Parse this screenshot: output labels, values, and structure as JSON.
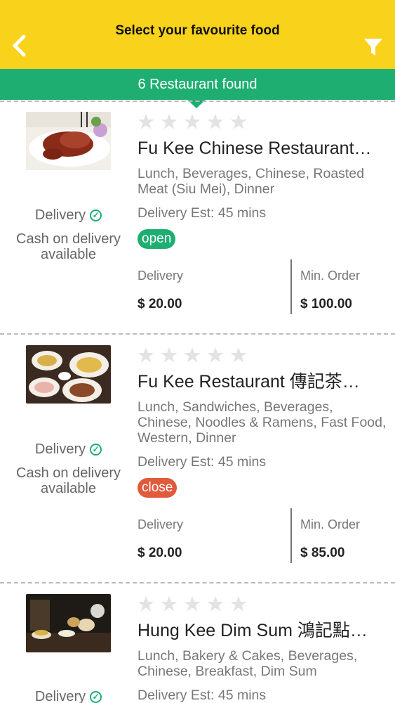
{
  "header": {
    "title": "Select your favourite food",
    "banner": "6 Restaurant found"
  },
  "colors": {
    "header_bg": "#f9d21b",
    "banner_bg": "#1fae72",
    "open_badge": "#1fae72",
    "close_badge": "#e05a3c"
  },
  "icons": [
    "back-arrow-icon",
    "filter-icon",
    "star-icon",
    "check-circle-icon"
  ],
  "restaurants": [
    {
      "name": "Fu Kee Chinese Restaurant…",
      "cuisines": "Lunch, Beverages, Chinese, Roasted Meat (Siu Mei), Dinner",
      "eta": "Delivery Est: 45 mins",
      "status": "open",
      "rating": 0,
      "delivery_label": "Delivery",
      "cash_label": "Cash on delivery available",
      "fee_label": "Delivery",
      "fee_value": "$ 20.00",
      "min_label": "Min. Order",
      "min_value": "$ 100.00"
    },
    {
      "name": "Fu Kee Restaurant 傳記茶…",
      "cuisines": "Lunch, Sandwiches, Beverages, Chinese, Noodles & Ramens, Fast Food, Western, Dinner",
      "eta": "Delivery Est: 45 mins",
      "status": "close",
      "rating": 0,
      "delivery_label": "Delivery",
      "cash_label": "Cash on delivery available",
      "fee_label": "Delivery",
      "fee_value": "$ 20.00",
      "min_label": "Min. Order",
      "min_value": "$ 85.00"
    },
    {
      "name": "Hung Kee Dim Sum 鴻記點…",
      "cuisines": "Lunch, Bakery & Cakes, Beverages, Chinese, Breakfast, Dim Sum",
      "eta": "Delivery Est: 45 mins",
      "rating": 0,
      "delivery_label": "Delivery"
    }
  ]
}
